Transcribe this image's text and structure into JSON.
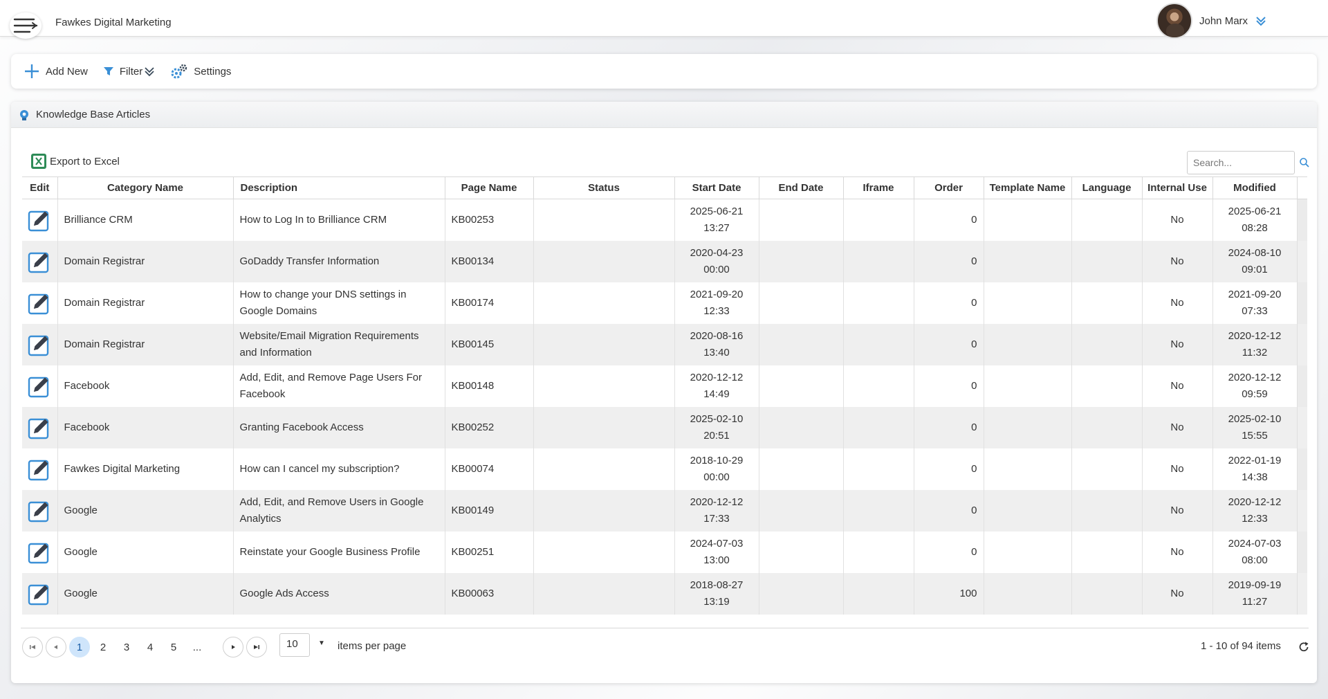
{
  "header": {
    "brand": "Fawkes Digital Marketing",
    "user_name": "John Marx"
  },
  "toolbar": {
    "add_new": "Add New",
    "filter": "Filter",
    "settings": "Settings"
  },
  "panel": {
    "title": "Knowledge Base Articles",
    "export_label": "Export to Excel",
    "search_placeholder": "Search..."
  },
  "columns": [
    "Edit",
    "Category Name",
    "Description",
    "Page Name",
    "Status",
    "Start Date",
    "End Date",
    "Iframe",
    "Order",
    "Template Name",
    "Language",
    "Internal Use",
    "Modified"
  ],
  "rows": [
    {
      "category": "Brilliance CRM",
      "description": "How to Log In to Brilliance CRM",
      "page": "KB00253",
      "status": "",
      "start_date": "2025-06-21",
      "start_time": "13:27",
      "end_date": "",
      "iframe": "",
      "order": "0",
      "template": "",
      "language": "",
      "internal": "No",
      "mod_date": "2025-06-21",
      "mod_time": "08:28"
    },
    {
      "category": "Domain Registrar",
      "description": "GoDaddy Transfer Information",
      "page": "KB00134",
      "status": "",
      "start_date": "2020-04-23",
      "start_time": "00:00",
      "end_date": "",
      "iframe": "",
      "order": "0",
      "template": "",
      "language": "",
      "internal": "No",
      "mod_date": "2024-08-10",
      "mod_time": "09:01"
    },
    {
      "category": "Domain Registrar",
      "description": "How to change your DNS settings in Google Domains",
      "page": "KB00174",
      "status": "",
      "start_date": "2021-09-20",
      "start_time": "12:33",
      "end_date": "",
      "iframe": "",
      "order": "0",
      "template": "",
      "language": "",
      "internal": "No",
      "mod_date": "2021-09-20",
      "mod_time": "07:33"
    },
    {
      "category": "Domain Registrar",
      "description": "Website/Email Migration Requirements and Information",
      "page": "KB00145",
      "status": "",
      "start_date": "2020-08-16",
      "start_time": "13:40",
      "end_date": "",
      "iframe": "",
      "order": "0",
      "template": "",
      "language": "",
      "internal": "No",
      "mod_date": "2020-12-12",
      "mod_time": "11:32"
    },
    {
      "category": "Facebook",
      "description": "Add, Edit, and Remove Page Users For Facebook",
      "page": "KB00148",
      "status": "",
      "start_date": "2020-12-12",
      "start_time": "14:49",
      "end_date": "",
      "iframe": "",
      "order": "0",
      "template": "",
      "language": "",
      "internal": "No",
      "mod_date": "2020-12-12",
      "mod_time": "09:59"
    },
    {
      "category": "Facebook",
      "description": "Granting Facebook Access",
      "page": "KB00252",
      "status": "",
      "start_date": "2025-02-10",
      "start_time": "20:51",
      "end_date": "",
      "iframe": "",
      "order": "0",
      "template": "",
      "language": "",
      "internal": "No",
      "mod_date": "2025-02-10",
      "mod_time": "15:55"
    },
    {
      "category": "Fawkes Digital Marketing",
      "description": "How can I cancel my subscription?",
      "page": "KB00074",
      "status": "",
      "start_date": "2018-10-29",
      "start_time": "00:00",
      "end_date": "",
      "iframe": "",
      "order": "0",
      "template": "",
      "language": "",
      "internal": "No",
      "mod_date": "2022-01-19",
      "mod_time": "14:38"
    },
    {
      "category": "Google",
      "description": "Add, Edit, and Remove Users in Google Analytics",
      "page": "KB00149",
      "status": "",
      "start_date": "2020-12-12",
      "start_time": "17:33",
      "end_date": "",
      "iframe": "",
      "order": "0",
      "template": "",
      "language": "",
      "internal": "No",
      "mod_date": "2020-12-12",
      "mod_time": "12:33"
    },
    {
      "category": "Google",
      "description": "Reinstate your Google Business Profile",
      "page": "KB00251",
      "status": "",
      "start_date": "2024-07-03",
      "start_time": "13:00",
      "end_date": "",
      "iframe": "",
      "order": "0",
      "template": "",
      "language": "",
      "internal": "No",
      "mod_date": "2024-07-03",
      "mod_time": "08:00"
    },
    {
      "category": "Google",
      "description": "Google Ads Access",
      "page": "KB00063",
      "status": "",
      "start_date": "2018-08-27",
      "start_time": "13:19",
      "end_date": "",
      "iframe": "",
      "order": "100",
      "template": "",
      "language": "",
      "internal": "No",
      "mod_date": "2019-09-19",
      "mod_time": "11:27"
    }
  ],
  "pager": {
    "pages": [
      "1",
      "2",
      "3",
      "4",
      "5",
      "..."
    ],
    "current_page": "1",
    "page_size": "10",
    "per_page_label": "items per page",
    "info": "1 - 10 of 94 items"
  },
  "colors": {
    "accent": "#3a8fd6",
    "edit_icon": "#3a3f4a",
    "row_alt": "#efefef",
    "active_page": "#cfe5fb"
  }
}
